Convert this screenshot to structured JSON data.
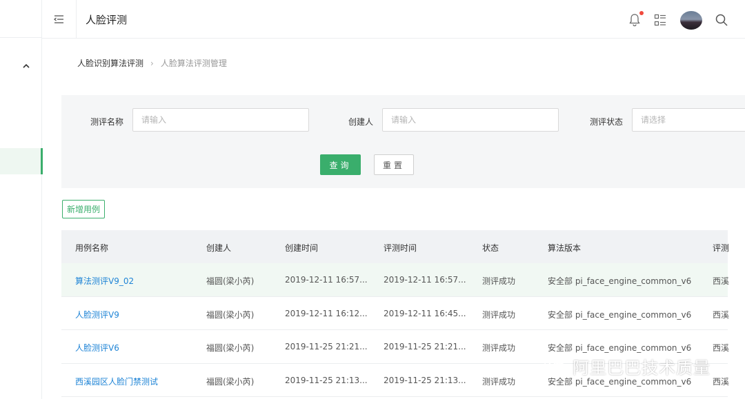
{
  "header": {
    "title": "人脸评测"
  },
  "breadcrumb": {
    "parent": "人脸识别算法评测",
    "current": "人脸算法评测管理"
  },
  "filter": {
    "name_label": "测评名称",
    "name_placeholder": "请输入",
    "creator_label": "创建人",
    "creator_placeholder": "请输入",
    "status_label": "测评状态",
    "status_placeholder": "请选择",
    "query_label": "查询",
    "reset_label": "重置"
  },
  "actions": {
    "add_label": "新增用例"
  },
  "table": {
    "columns": [
      "用例名称",
      "创建人",
      "创建时间",
      "评测时间",
      "状态",
      "算法版本",
      "评测"
    ],
    "rows": [
      [
        "算法测评V9_02",
        "福圆(梁小芮)",
        "2019-12-11 16:57...",
        "2019-12-11 16:57...",
        "测评成功",
        "安全部 pi_face_engine_common_v6",
        "西溪"
      ],
      [
        "人脸测评V9",
        "福圆(梁小芮)",
        "2019-12-11 16:12...",
        "2019-12-11 16:45...",
        "测评成功",
        "安全部 pi_face_engine_common_v6",
        "西溪"
      ],
      [
        "人脸测评V6",
        "福圆(梁小芮)",
        "2019-11-25 21:21...",
        "2019-11-25 21:21...",
        "测评成功",
        "安全部 pi_face_engine_common_v6",
        "西溪"
      ],
      [
        "西溪园区人脸门禁测试",
        "福圆(梁小芮)",
        "2019-11-25 21:13...",
        "2019-11-25 21:13...",
        "测评成功",
        "安全部 pi_face_engine_common_v6",
        "西溪"
      ]
    ]
  },
  "watermark": {
    "text": "阿里巴巴技术质量"
  },
  "colors": {
    "accent": "#3aae6c",
    "link": "#1f84d6",
    "notification": "#f04a3d"
  },
  "icons": [
    "menu-fold-icon",
    "chevron-up-icon",
    "bell-icon",
    "apps-icon",
    "search-icon",
    "wechat-icon"
  ]
}
